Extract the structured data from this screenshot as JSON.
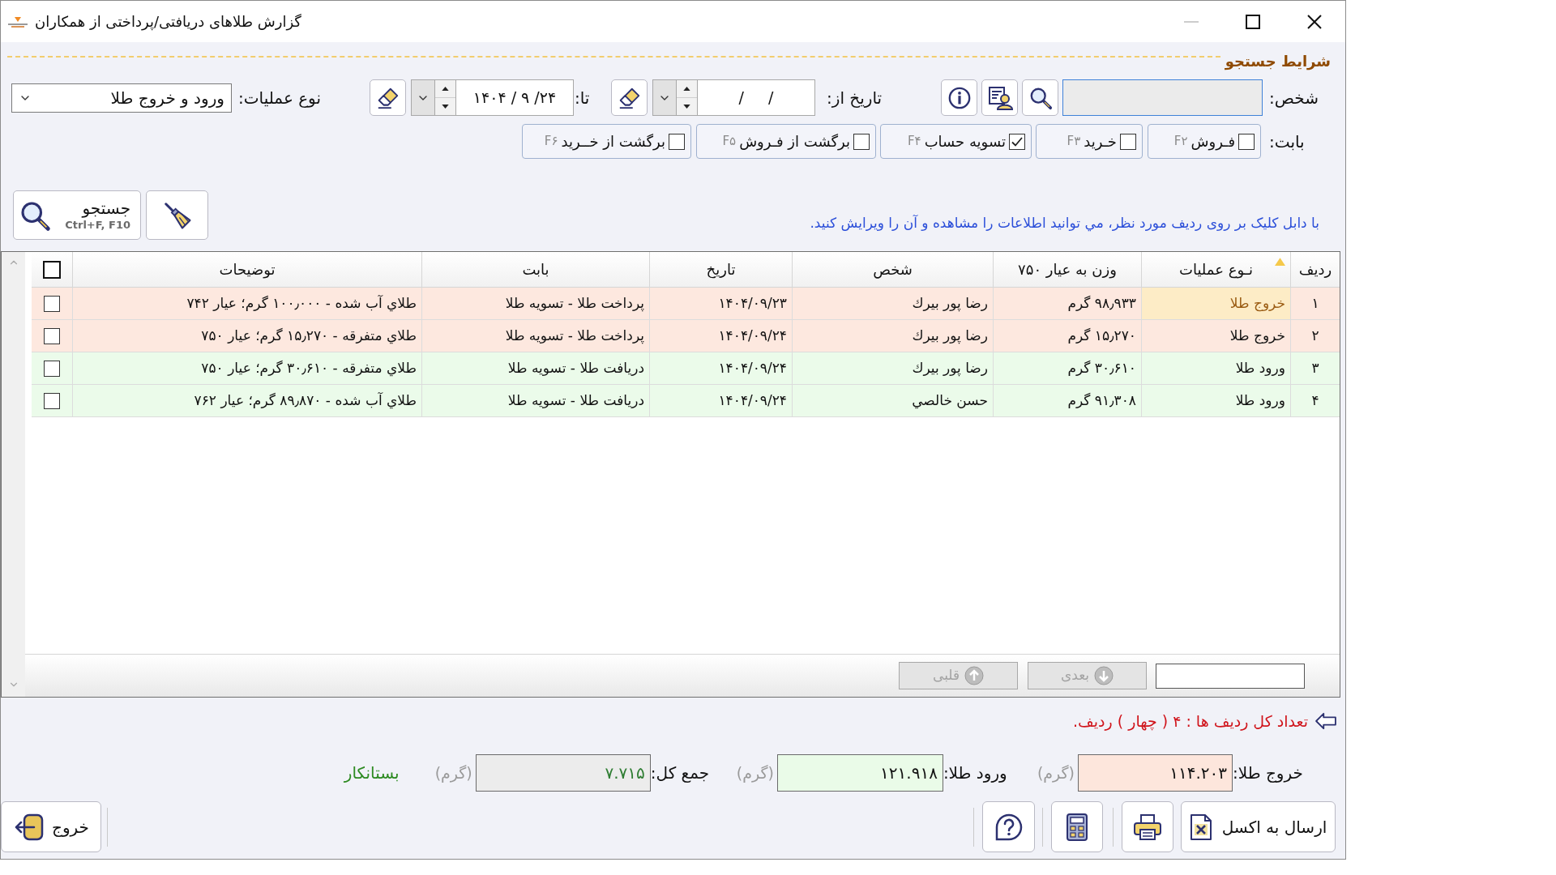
{
  "window": {
    "title": "گزارش طلاهای دریافتی/پرداختی از همکاران",
    "controls": [
      {
        "kind": "minimize",
        "disabled": true
      },
      {
        "kind": "maximize",
        "disabled": false
      },
      {
        "kind": "close",
        "disabled": false
      }
    ]
  },
  "search_conditions": {
    "title": "شرایط جستجو",
    "person": {
      "label": "شخص:"
    },
    "date_from": {
      "label": "تاریخ از:",
      "value": "/     /"
    },
    "date_to": {
      "label": "تا:",
      "value": "۱۴۰۴ / ۹ /۲۴"
    },
    "operation_type": {
      "label": "نوع عملیات:",
      "value": "ورود و خروج طلا"
    },
    "category": {
      "label": "بابت:",
      "options": [
        {
          "label": "فـروش",
          "key": "F۲",
          "checked": false
        },
        {
          "label": "خـرید",
          "key": "F۳",
          "checked": false
        },
        {
          "label": "تسویه حساب",
          "key": "F۴",
          "checked": true
        },
        {
          "label": "برگشت از فـروش",
          "key": "F۵",
          "checked": false
        },
        {
          "label": "برگشت از خــرید",
          "key": "F۶",
          "checked": false
        }
      ]
    },
    "search_button": {
      "label": "جستجو",
      "shortcut": "Ctrl+F, F10"
    },
    "hint": "با دابل کلیک بر روی ردیف مورد نظر، مي توانيد اطلاعات را مشاهده و آن را ویرایش کنید."
  },
  "table": {
    "columns": [
      {
        "label": "ردیف",
        "sorted": false
      },
      {
        "label": "نـوع عملیات",
        "sorted": true
      },
      {
        "label": "وزن به عیار ۷۵۰",
        "sorted": false
      },
      {
        "label": "شخص",
        "sorted": false
      },
      {
        "label": "تاریخ",
        "sorted": false
      },
      {
        "label": "بابت",
        "sorted": false
      },
      {
        "label": "توضیحات",
        "sorted": false
      }
    ],
    "select_all": {
      "checked": false
    },
    "rows": [
      {
        "kind": "outgoing",
        "selected": true,
        "checked": false,
        "cells": [
          "۱",
          "خروج طلا",
          "۹۸٫۹۳۳ گرم",
          "رضا پور بیرك",
          "۱۴۰۴/۰۹/۲۳",
          "پرداخت طلا - تسویه طلا",
          "طلاي آب شده - ۱۰۰٫۰۰۰ گرم؛ عیار ۷۴۲"
        ]
      },
      {
        "kind": "outgoing",
        "selected": false,
        "checked": false,
        "cells": [
          "۲",
          "خروج طلا",
          "۱۵٫۲۷۰ گرم",
          "رضا پور بیرك",
          "۱۴۰۴/۰۹/۲۴",
          "پرداخت طلا - تسویه طلا",
          "طلاي متفرقه - ۱۵٫۲۷۰ گرم؛ عیار ۷۵۰"
        ]
      },
      {
        "kind": "incoming",
        "selected": false,
        "checked": false,
        "cells": [
          "۳",
          "ورود طلا",
          "۳۰٫۶۱۰ گرم",
          "رضا پور بیرك",
          "۱۴۰۴/۰۹/۲۴",
          "دریافت طلا - تسویه طلا",
          "طلاي متفرقه - ۳۰٫۶۱۰ گرم؛ عیار ۷۵۰"
        ]
      },
      {
        "kind": "incoming",
        "selected": false,
        "checked": false,
        "cells": [
          "۴",
          "ورود طلا",
          "۹۱٫۳۰۸ گرم",
          "حسن خالصي",
          "۱۴۰۴/۰۹/۲۴",
          "دریافت طلا - تسویه طلا",
          "طلاي آب شده - ۸۹٫۸۷۰ گرم؛ عیار ۷۶۲"
        ]
      }
    ],
    "pager": {
      "buttons": [
        {
          "kind": "next",
          "label": "بعدی",
          "disabled": true
        },
        {
          "kind": "previous",
          "label": "قلبی",
          "disabled": true
        }
      ]
    }
  },
  "footer": {
    "row_count": "تعداد کل ردیف ها : ۴ ( چهار ) ردیف.",
    "totals": [
      {
        "kind": "outgoing",
        "label": "خروج طلا:",
        "value": "۱۱۴.۲۰۳",
        "unit": "(گرم)"
      },
      {
        "kind": "incoming",
        "label": "ورود طلا:",
        "value": "۱۲۱.۹۱۸",
        "unit": "(گرم)"
      },
      {
        "kind": "net",
        "label": "جمع کل:",
        "value": "۷.۷۱۵",
        "unit": "(گرم)"
      }
    ],
    "balance": "بستانکار",
    "buttons": [
      {
        "kind": "excel",
        "label": "ارسال به اکسل"
      },
      {
        "kind": "print"
      },
      {
        "kind": "calculator"
      },
      {
        "kind": "help"
      }
    ],
    "exit_button": {
      "label": "خروج"
    }
  }
}
